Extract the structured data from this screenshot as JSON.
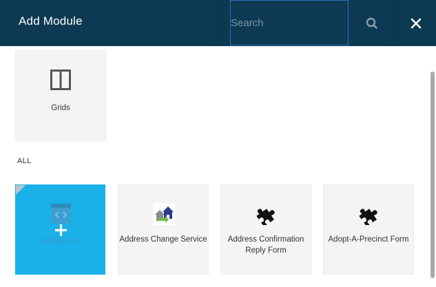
{
  "header": {
    "title": "Add Module",
    "search_placeholder": "Search",
    "search_value": ""
  },
  "top_modules": [
    {
      "label": "Grids",
      "icon": "grid-columns-icon"
    }
  ],
  "section": {
    "label": "ALL"
  },
  "modules": [
    {
      "label": "HTML Pro",
      "icon": "code-window-icon",
      "state": "hover"
    },
    {
      "label": "Address Change Service",
      "icon": "house-address-icon"
    },
    {
      "label": "Address Confirmation Reply Form",
      "icon": "puzzle-piece-icon"
    },
    {
      "label": "Adopt-A-Precinct Form",
      "icon": "puzzle-piece-icon"
    }
  ],
  "colors": {
    "header_bg": "#0d3a52",
    "search_border": "#2e6fc7",
    "tile_bg": "#f4f4f5",
    "active_tile_bg": "#1ab0e8"
  }
}
